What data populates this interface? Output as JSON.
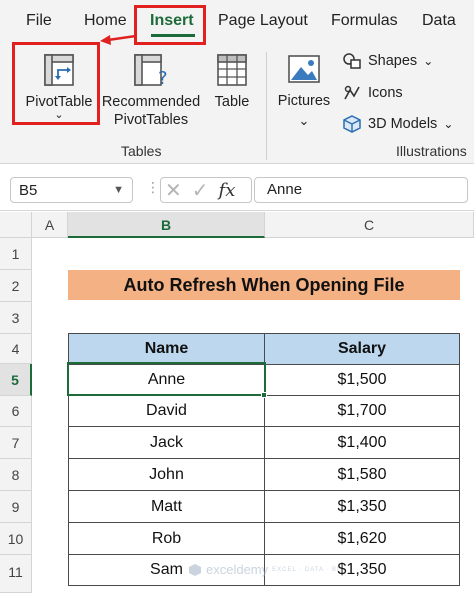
{
  "ribbon_tabs": [
    {
      "label": "File"
    },
    {
      "label": "Home"
    },
    {
      "label": "Insert"
    },
    {
      "label": "Page Layout"
    },
    {
      "label": "Formulas"
    },
    {
      "label": "Data"
    }
  ],
  "active_tab": "Insert",
  "ribbon": {
    "pivottable": {
      "label": "PivotTable",
      "caret": "⌄"
    },
    "recommended_pivottables": {
      "label_line1": "Recommended",
      "label_line2": "PivotTables"
    },
    "table": {
      "label": "Table"
    },
    "pictures": {
      "label": "Pictures",
      "caret": "⌄"
    },
    "shapes": {
      "label": "Shapes",
      "caret": "⌄"
    },
    "icons": {
      "label": "Icons"
    },
    "models_3d": {
      "label": "3D Models",
      "caret": "⌄"
    },
    "group_tables": "Tables",
    "group_illustrations": "Illustrations"
  },
  "formula_bar": {
    "name_box": "B5",
    "fx_symbol": "fx",
    "value": "Anne"
  },
  "grid": {
    "columns": [
      "A",
      "B",
      "C"
    ],
    "rows": [
      "1",
      "2",
      "3",
      "4",
      "5",
      "6",
      "7",
      "8",
      "9",
      "10",
      "11"
    ],
    "selected_column": "B",
    "selected_row": "5",
    "title": "Auto Refresh When Opening File",
    "table": {
      "headers": [
        "Name",
        "Salary"
      ],
      "rows": [
        [
          "Anne",
          "$1,500"
        ],
        [
          "David",
          "$1,700"
        ],
        [
          "Jack",
          "$1,400"
        ],
        [
          "John",
          "$1,580"
        ],
        [
          "Matt",
          "$1,350"
        ],
        [
          "Rob",
          "$1,620"
        ],
        [
          "Sam",
          "$1,350"
        ]
      ]
    }
  },
  "watermark": {
    "brand": "exceldemy",
    "tagline": "EXCEL · DATA · BI"
  },
  "colors": {
    "accent_green": "#1e6b3a",
    "annotation_red": "#e0211f",
    "title_fill": "#f4b183",
    "header_fill": "#bdd7ee"
  }
}
